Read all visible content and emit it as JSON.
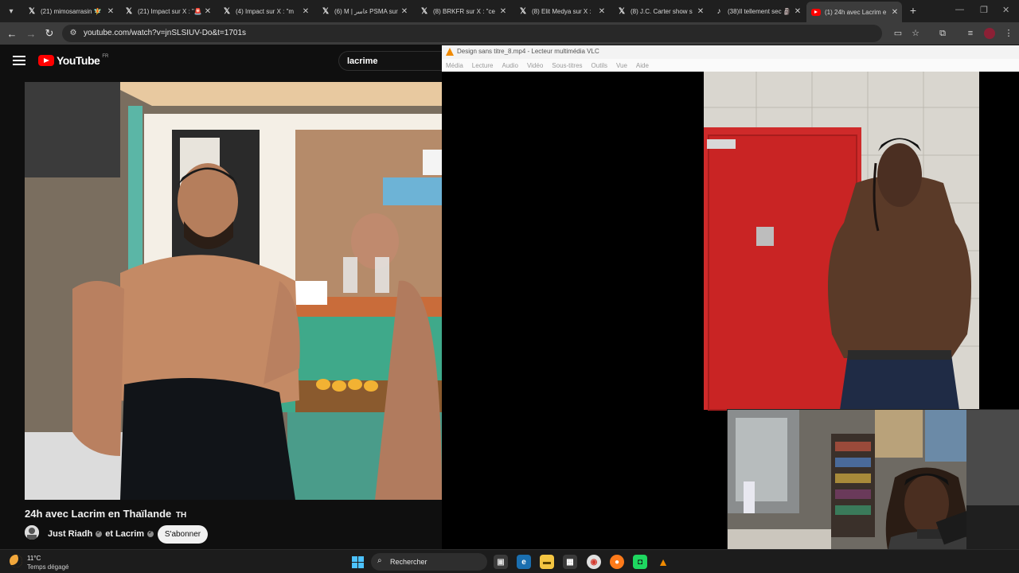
{
  "browser": {
    "tabs": [
      {
        "icon": "x-icon",
        "title": "(21) mimosarrasin 🧚",
        "active": false
      },
      {
        "icon": "x-icon",
        "title": "(21) Impact sur X : \"🚨",
        "active": false
      },
      {
        "icon": "x-icon",
        "title": "(4) Impact sur X : \"m",
        "active": false
      },
      {
        "icon": "x-icon",
        "title": "(6) M | ﺀﺎﺳﺭ PSMA sur X",
        "active": false
      },
      {
        "icon": "x-icon",
        "title": "(8) BRKFR sur X : \"ce",
        "active": false
      },
      {
        "icon": "x-icon",
        "title": "(8) Elit Medya sur X :",
        "active": false
      },
      {
        "icon": "x-icon",
        "title": "(8) J.C. Carter show s",
        "active": false
      },
      {
        "icon": "tiktok-icon",
        "title": "(38)Il tellement sec 🗿",
        "active": false
      },
      {
        "icon": "youtube-icon",
        "title": "(1) 24h avec Lacrim e",
        "active": true
      }
    ],
    "url": "youtube.com/watch?v=jnSLSIUV-Do&t=1701s"
  },
  "youtube": {
    "logo_text": "YouTube",
    "country_code": "FR",
    "search_query": "lacrime",
    "video_title": "24h avec Lacrim en Thaïlande",
    "video_title_flag": "TH",
    "channel_1": "Just Riadh",
    "channel_join": "et",
    "channel_2": "Lacrim",
    "subscribe_label": "S'abonner"
  },
  "vlc": {
    "window_title": "Design sans titre_8.mp4 - Lecteur multimédia VLC",
    "menu": [
      "Média",
      "Lecture",
      "Audio",
      "Vidéo",
      "Sous-titres",
      "Outils",
      "Vue",
      "Aide"
    ]
  },
  "taskbar": {
    "temperature": "11°C",
    "weather": "Temps dégagé",
    "search_placeholder": "Rechercher"
  }
}
